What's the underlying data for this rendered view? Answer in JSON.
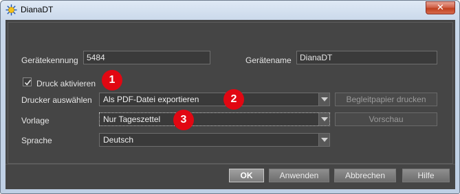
{
  "window": {
    "title": "DianaDT",
    "close_glyph": "✕"
  },
  "form": {
    "device_id_label": "Gerätekennung",
    "device_id_value": "5484",
    "device_name_label": "Gerätename",
    "device_name_value": "DianaDT",
    "print_enabled_label": "Druck aktivieren",
    "print_enabled_checked": true,
    "printer_label": "Drucker auswählen",
    "printer_value": "Als PDF-Datei exportieren",
    "template_label": "Vorlage",
    "template_value": "Nur Tageszettel",
    "language_label": "Sprache",
    "language_value": "Deutsch",
    "print_cover_button": "Begleitpapier drucken",
    "preview_button": "Vorschau"
  },
  "badges": [
    "1",
    "2",
    "3"
  ],
  "footer": {
    "ok": "OK",
    "apply": "Anwenden",
    "cancel": "Abbrechen",
    "help": "Hilfe"
  },
  "colors": {
    "badge": "#e10712",
    "client_bg": "#454545",
    "title_bg": "#c9d8ea"
  }
}
